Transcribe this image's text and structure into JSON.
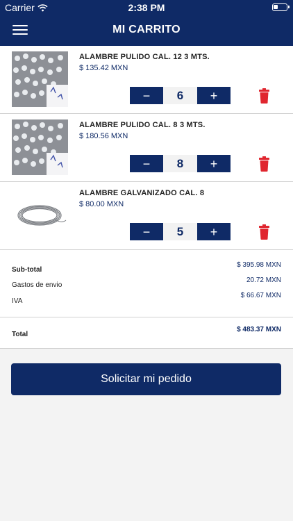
{
  "status_bar": {
    "carrier": "Carrier",
    "time": "2:38 PM"
  },
  "header": {
    "title": "MI CARRITO"
  },
  "icons": {
    "menu": "hamburger-icon",
    "trash": "trash-icon",
    "wifi": "wifi-icon",
    "battery": "battery-icon"
  },
  "colors": {
    "brand": "#0f2a66",
    "delete": "#e0262f",
    "background": "#f3f3f3"
  },
  "cart": {
    "items": [
      {
        "name": "ALAMBRE PULIDO CAL. 12 3 MTS.",
        "price": "$ 135.42 MXN",
        "quantity": "6",
        "minus": "−",
        "plus": "+"
      },
      {
        "name": "ALAMBRE PULIDO CAL. 8 3 MTS.",
        "price": "$ 180.56 MXN",
        "quantity": "8",
        "minus": "−",
        "plus": "+"
      },
      {
        "name": "ALAMBRE GALVANIZADO CAL. 8",
        "price": "$ 80.00 MXN",
        "quantity": "5",
        "minus": "−",
        "plus": "+"
      }
    ]
  },
  "summary": {
    "subtotal_label": "Sub-total",
    "subtotal_value": "$ 395.98 MXN",
    "shipping_label": "Gastos de envio",
    "shipping_value": "20.72 MXN",
    "tax_label": "IVA",
    "tax_value": "$ 66.67 MXN",
    "total_label": "Total",
    "total_value": "$ 483.37 MXN"
  },
  "actions": {
    "submit_label": "Solicitar mi pedido"
  }
}
